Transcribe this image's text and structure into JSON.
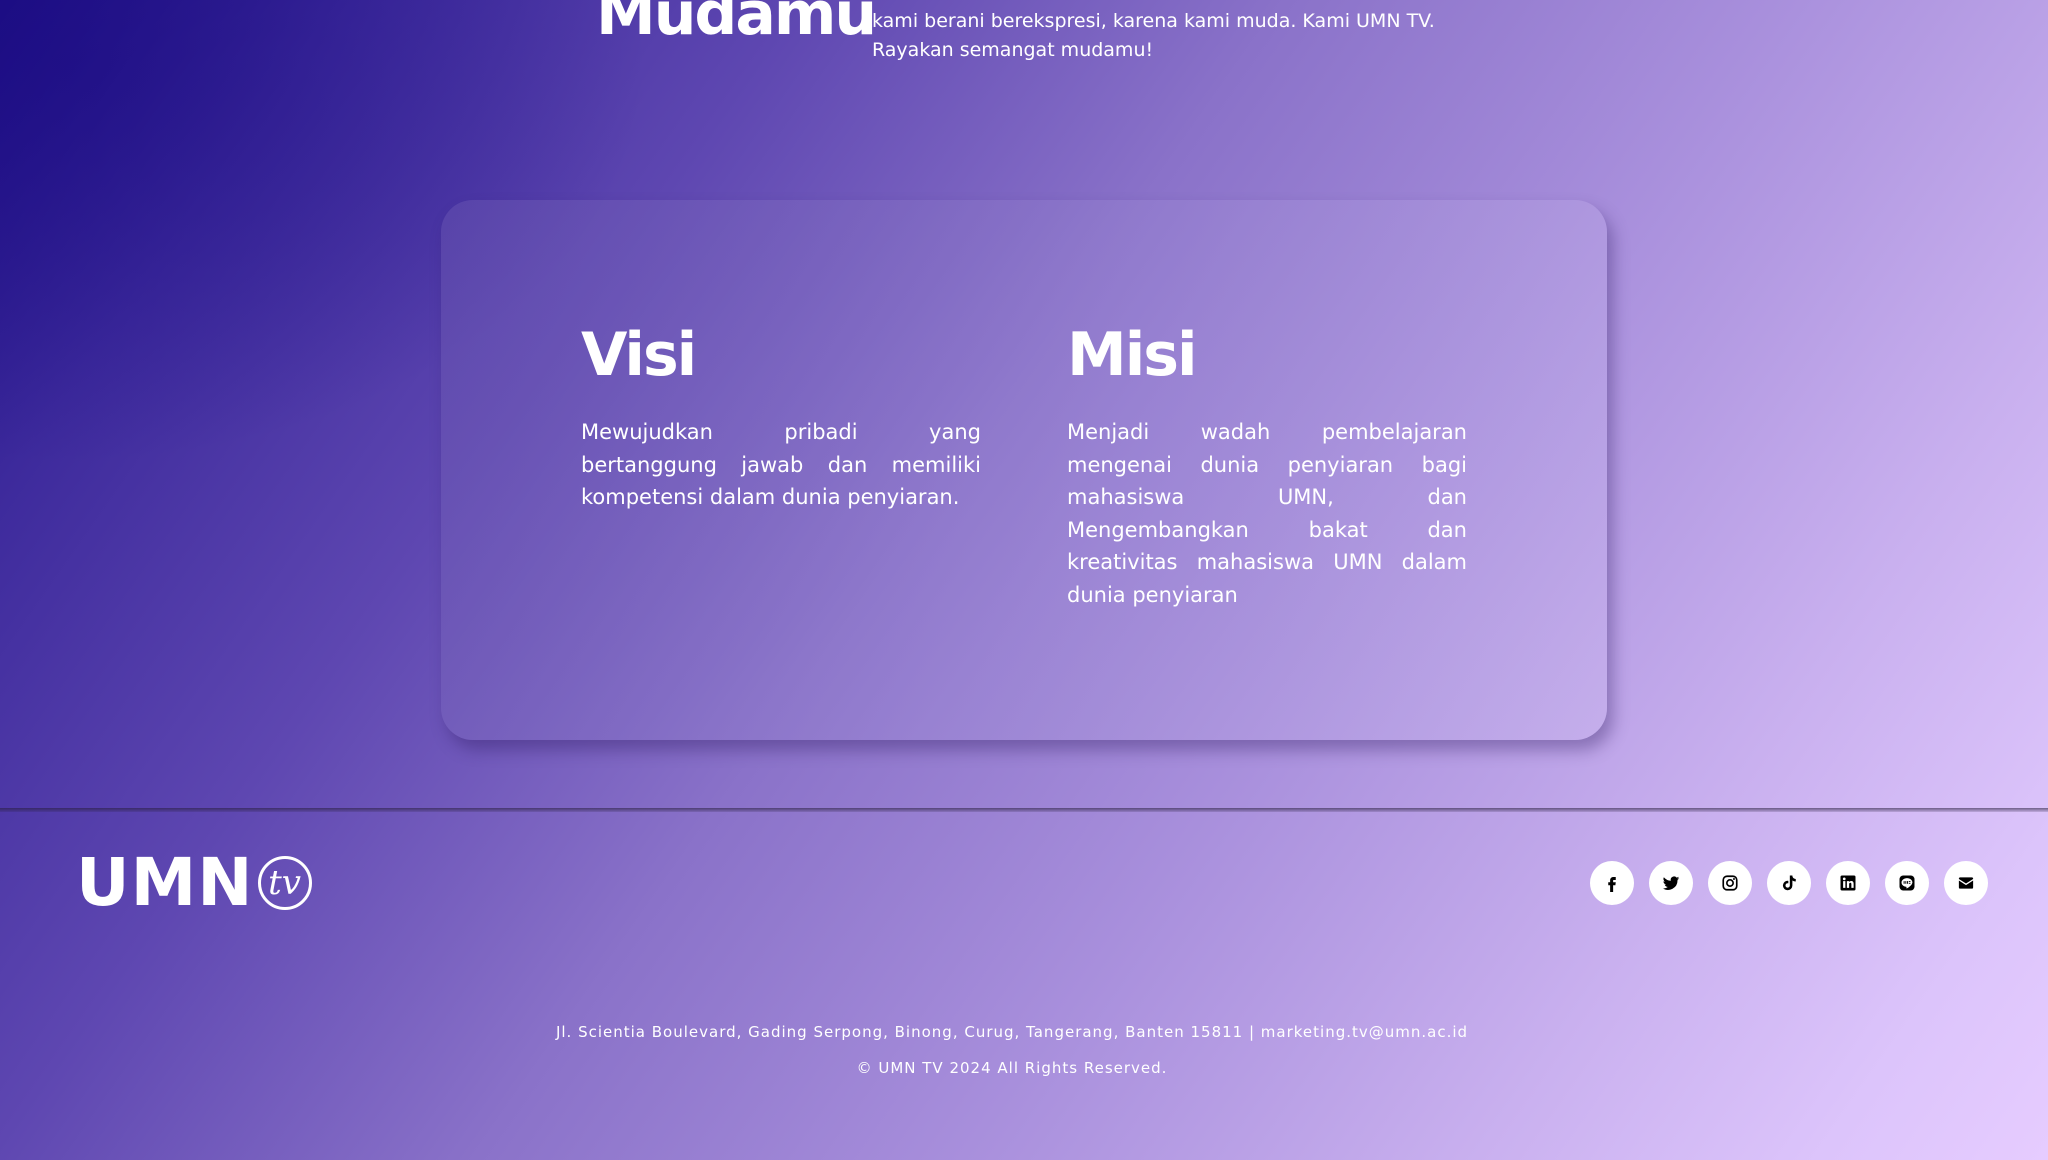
{
  "hero": {
    "title": "Mudamu",
    "text": "kami berani berekspresi, karena kami muda. Kami UMN TV. Rayakan semangat mudamu!"
  },
  "vision": {
    "heading": "Visi",
    "text": "Mewujudkan pribadi yang bertanggung jawab dan memiliki kompetensi dalam dunia penyiaran."
  },
  "mission": {
    "heading": "Misi",
    "text": "Menjadi wadah pembelajaran mengenai dunia penyiaran bagi mahasiswa UMN, dan Mengembangkan bakat dan kreativitas mahasiswa UMN dalam dunia penyiaran"
  },
  "footer": {
    "logo": {
      "text": "UMN",
      "badge": "tv"
    },
    "social": [
      {
        "name": "facebook-icon"
      },
      {
        "name": "twitter-icon"
      },
      {
        "name": "instagram-icon"
      },
      {
        "name": "tiktok-icon"
      },
      {
        "name": "linkedin-icon"
      },
      {
        "name": "line-icon"
      },
      {
        "name": "email-icon"
      }
    ],
    "address": "Jl. Scientia Boulevard, Gading Serpong, Binong, Curug, Tangerang, Banten 15811 | marketing.tv@umn.ac.id",
    "copyright": "© UMN TV 2024 All Rights Reserved."
  },
  "colors": {
    "background_start": "#1e0f85",
    "background_end": "#e6ccff",
    "text": "#ffffff",
    "icon": "#000000"
  }
}
